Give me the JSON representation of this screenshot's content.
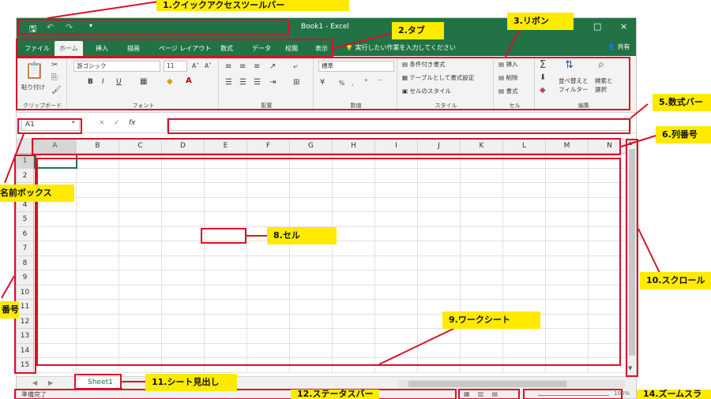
{
  "window": {
    "title": "Book1 - Excel",
    "restore_glyph": "□",
    "close_glyph": "×"
  },
  "quick_access": {
    "save_icon": "save-icon",
    "undo_icon": "undo-icon",
    "redo_icon": "redo-icon",
    "customize_glyph": "▾"
  },
  "tabs": [
    {
      "label": "ファイル"
    },
    {
      "label": "ホーム"
    },
    {
      "label": "挿入"
    },
    {
      "label": "描画"
    },
    {
      "label": "ページ レイアウト"
    },
    {
      "label": "数式"
    },
    {
      "label": "データ"
    },
    {
      "label": "校閲"
    },
    {
      "label": "表示"
    }
  ],
  "tell_me": "実行したい作業を入力してください",
  "share": "共有",
  "ribbon": {
    "clipboard": {
      "paste": "貼り付け",
      "label": "クリップボード"
    },
    "font": {
      "name": "游ゴシック",
      "size": "11",
      "bold": "B",
      "italic": "I",
      "underline": "U",
      "grow": "A˄",
      "shrink": "A˅",
      "label": "フォント"
    },
    "align": {
      "label": "配置"
    },
    "number": {
      "format": "標準",
      "percent": "%",
      "comma": ",",
      "label": "数値"
    },
    "styles": {
      "cond": "条件付き書式",
      "table": "テーブルとして書式設定",
      "cell": "セルのスタイル",
      "label": "スタイル"
    },
    "cells": {
      "insert": "挿入",
      "delete": "削除",
      "format": "書式",
      "label": "セル"
    },
    "editing": {
      "sort": "並べ替えと",
      "filter": "フィルター",
      "find": "検索と",
      "select": "選択",
      "label": "編集"
    }
  },
  "formula_bar": {
    "name_box": "A1",
    "cancel": "×",
    "enter": "✓",
    "fx": "fx",
    "value": ""
  },
  "columns": [
    "A",
    "B",
    "C",
    "D",
    "E",
    "F",
    "G",
    "H",
    "I",
    "J",
    "K",
    "L",
    "M",
    "N"
  ],
  "rows": [
    "1",
    "2",
    "3",
    "4",
    "5",
    "6",
    "7",
    "8",
    "9",
    "10",
    "11",
    "12",
    "13",
    "14",
    "15"
  ],
  "active_cell": "A1",
  "sheet_tab": "Sheet1",
  "status": "準備完了",
  "zoom": "100%",
  "accent_color": "#217346",
  "annotation_color": "#d9102a",
  "label_color": "#ffea00",
  "annotations": {
    "quick_access": "1.クイックアクセスツールバー",
    "tabs": "2.タブ",
    "ribbon": "3.リボン",
    "name_box": "名前ボックス",
    "formula_bar": "5.数式バー",
    "col_header": "6.列番号",
    "row_header": "番号",
    "cell": "8.セル",
    "worksheet": "9.ワークシート",
    "scrollbar": "10.スクロール",
    "sheet_tab": "11.シート見出し",
    "status_bar": "12.ステータスバー",
    "zoom_slider": "14.ズームスラ"
  }
}
